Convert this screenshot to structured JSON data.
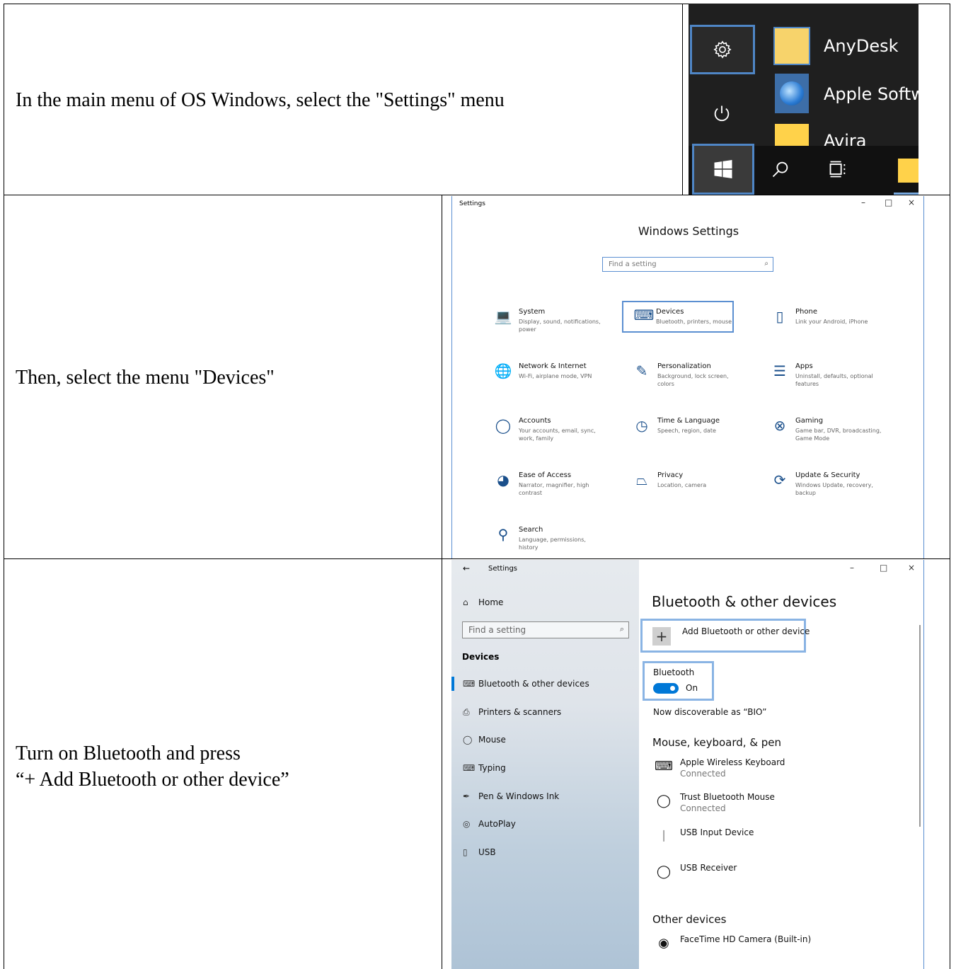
{
  "steps": [
    "In the main menu of OS Windows, select the \"Settings\" menu",
    "Then, select the menu \"Devices\"",
    "Turn on Bluetooth and press",
    "“+ Add Bluetooth or other device”"
  ],
  "start_menu": {
    "apps": [
      "AnyDesk",
      "Apple Softwa",
      "Avira"
    ],
    "icons": [
      "gear-icon",
      "power-icon",
      "windows-logo-icon",
      "search-icon",
      "task-view-icon",
      "folder-icon"
    ]
  },
  "settings_window": {
    "title": "Settings",
    "controls": [
      "–",
      "□",
      "×"
    ],
    "heading": "Windows Settings",
    "search_placeholder": "Find a setting",
    "categories": [
      {
        "name": "System",
        "desc": "Display, sound, notifications, power",
        "icon": "laptop-icon"
      },
      {
        "name": "Devices",
        "desc": "Bluetooth, printers, mouse",
        "icon": "devices-icon"
      },
      {
        "name": "Phone",
        "desc": "Link your Android, iPhone",
        "icon": "phone-icon"
      },
      {
        "name": "Network & Internet",
        "desc": "Wi-Fi, airplane mode, VPN",
        "icon": "globe-icon"
      },
      {
        "name": "Personalization",
        "desc": "Background, lock screen, colors",
        "icon": "brush-icon"
      },
      {
        "name": "Apps",
        "desc": "Uninstall, defaults, optional features",
        "icon": "apps-list-icon"
      },
      {
        "name": "Accounts",
        "desc": "Your accounts, email, sync, work, family",
        "icon": "person-icon"
      },
      {
        "name": "Time & Language",
        "desc": "Speech, region, date",
        "icon": "time-language-icon"
      },
      {
        "name": "Gaming",
        "desc": "Game bar, DVR, broadcasting, Game Mode",
        "icon": "xbox-icon"
      },
      {
        "name": "Ease of Access",
        "desc": "Narrator, magnifier, high contrast",
        "icon": "ease-of-access-icon"
      },
      {
        "name": "Privacy",
        "desc": "Location, camera",
        "icon": "lock-icon"
      },
      {
        "name": "Update & Security",
        "desc": "Windows Update, recovery, backup",
        "icon": "sync-icon"
      },
      {
        "name": "Search",
        "desc": "Language, permissions, history",
        "icon": "search-icon"
      }
    ]
  },
  "bluetooth_window": {
    "title": "Settings",
    "back": "←",
    "controls": [
      "–",
      "□",
      "×"
    ],
    "home": "Home",
    "search_placeholder": "Find a setting",
    "section": "Devices",
    "nav": [
      {
        "label": "Bluetooth & other devices",
        "icon": "devices-icon"
      },
      {
        "label": "Printers & scanners",
        "icon": "printer-icon"
      },
      {
        "label": "Mouse",
        "icon": "mouse-icon"
      },
      {
        "label": "Typing",
        "icon": "keyboard-icon"
      },
      {
        "label": "Pen & Windows Ink",
        "icon": "pen-icon"
      },
      {
        "label": "AutoPlay",
        "icon": "autoplay-icon"
      },
      {
        "label": "USB",
        "icon": "usb-icon"
      }
    ],
    "heading": "Bluetooth & other devices",
    "add_button": "Add Bluetooth or other device",
    "add_symbol": "+",
    "bluetooth_label": "Bluetooth",
    "bluetooth_state": "On",
    "discoverable": "Now discoverable as “BIO”",
    "group1": "Mouse, keyboard, & pen",
    "devices": [
      {
        "name": "Apple Wireless Keyboard",
        "status": "Connected",
        "icon": "keyboard-icon"
      },
      {
        "name": "Trust Bluetooth Mouse",
        "status": "Connected",
        "icon": "mouse-icon"
      },
      {
        "name": "USB Input Device",
        "status": "",
        "icon": "bluetooth-icon"
      },
      {
        "name": "USB Receiver",
        "status": "",
        "icon": "mouse-icon"
      }
    ],
    "group2": "Other devices",
    "other_devices": [
      {
        "name": "FaceTime HD Camera (Built-in)",
        "icon": "webcam-icon"
      }
    ]
  },
  "colors": {
    "accent": "#0078d7",
    "highlight": "#5b8fd1",
    "tile": "#ffd24a"
  }
}
